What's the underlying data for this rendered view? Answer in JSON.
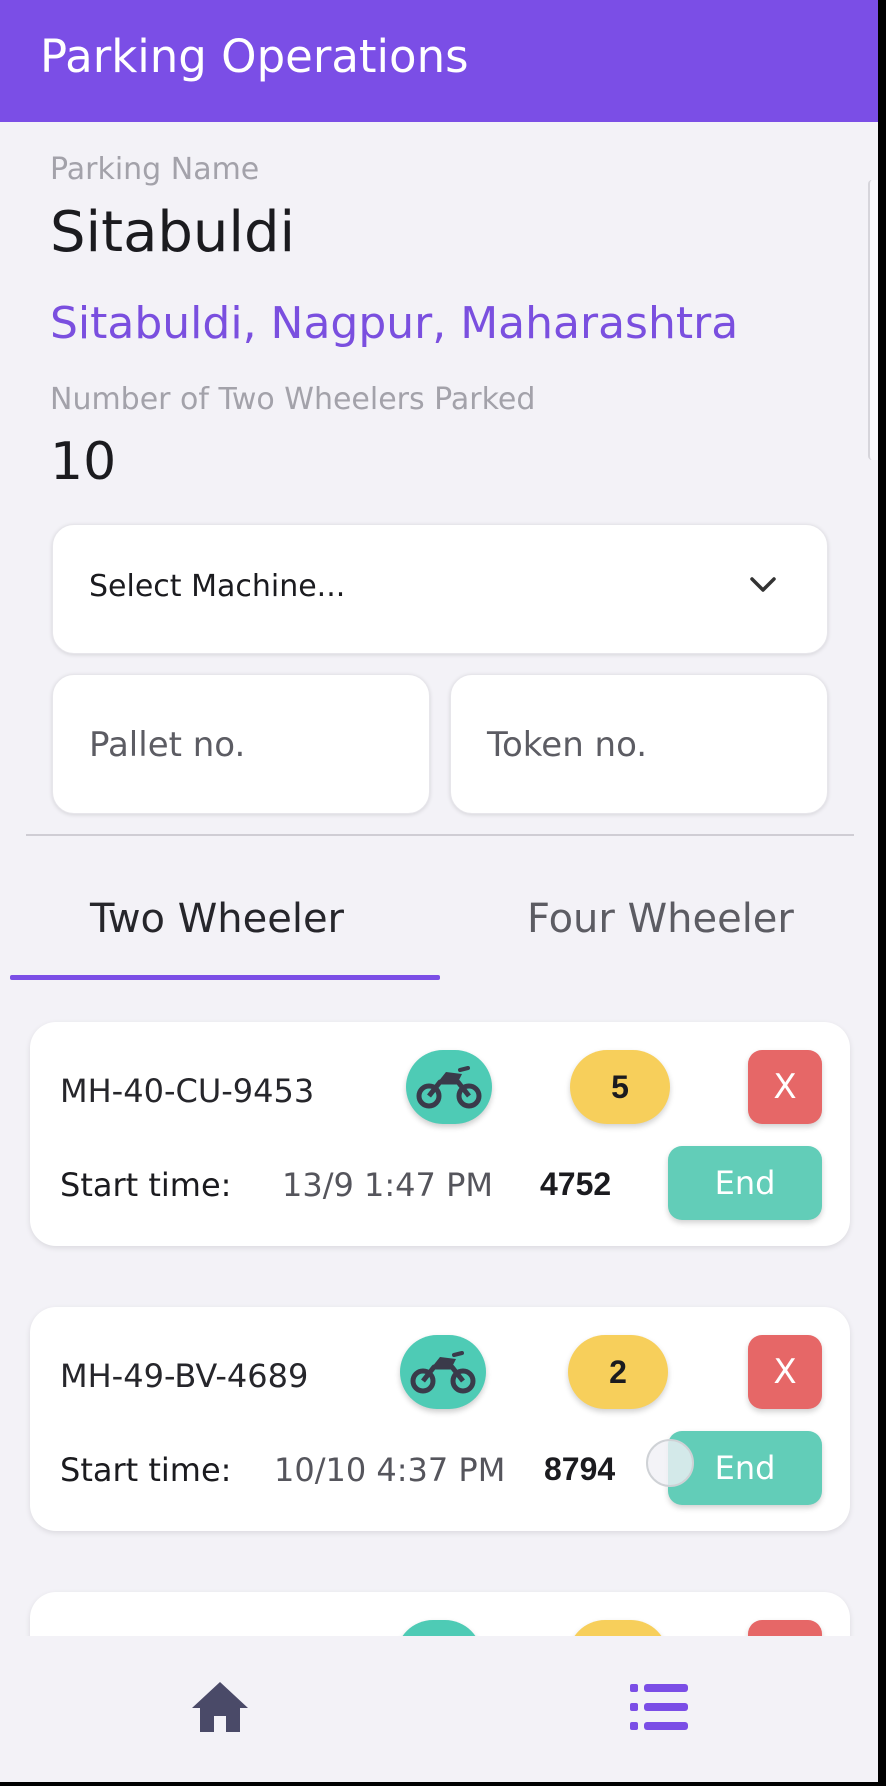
{
  "app_bar": {
    "title": "Parking Operations"
  },
  "parking": {
    "name_label": "Parking Name",
    "name": "Sitabuldi",
    "address": "Sitabuldi, Nagpur, Maharashtra",
    "count_label": "Number of Two Wheelers Parked",
    "count": "10"
  },
  "form": {
    "machine_select": "Select Machine...",
    "pallet_placeholder": "Pallet no.",
    "token_placeholder": "Token no."
  },
  "tabs": [
    {
      "label": "Two Wheeler",
      "active": true
    },
    {
      "label": "Four Wheeler",
      "active": false
    }
  ],
  "entries": [
    {
      "plate": "MH-40-CU-9453",
      "pallet": "5",
      "remove_label": "X",
      "start_label": "Start time:",
      "start_time": "13/9 1:47 PM",
      "token": "4752",
      "end_label": "End"
    },
    {
      "plate": "MH-49-BV-4689",
      "pallet": "2",
      "remove_label": "X",
      "start_label": "Start time:",
      "start_time": "10/10 4:37 PM",
      "token": "8794",
      "end_label": "End"
    }
  ],
  "colors": {
    "primary": "#7b4ee6",
    "vehicle_badge": "#4ecbb5",
    "pallet_badge": "#f7cf5b",
    "remove": "#e66767",
    "end": "#62cdb8",
    "nav_home": "#4a4a68",
    "nav_list": "#7b4ee6"
  },
  "bottom_nav": {
    "icons": [
      "home-icon",
      "list-icon"
    ]
  }
}
